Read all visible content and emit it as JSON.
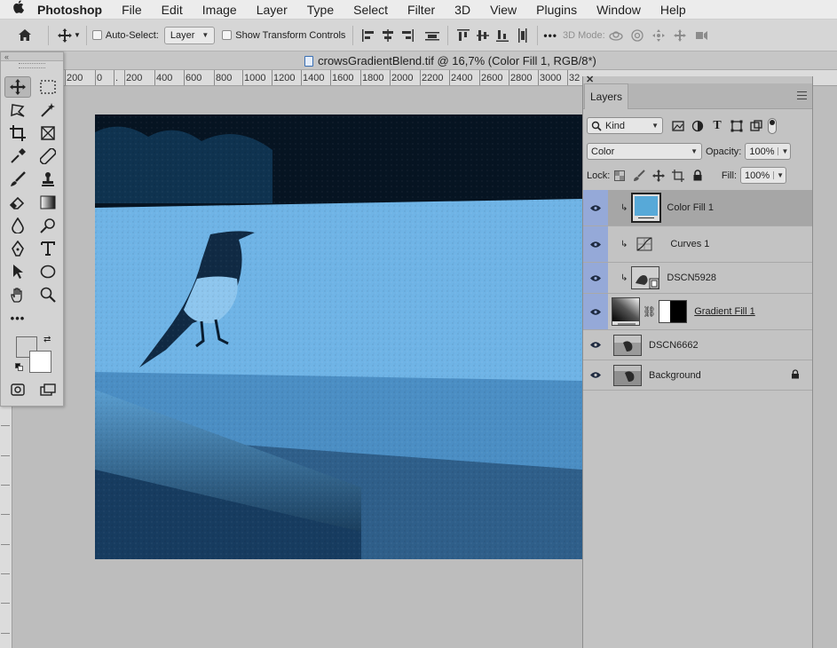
{
  "menubar": {
    "app": "Photoshop",
    "items": [
      "File",
      "Edit",
      "Image",
      "Layer",
      "Type",
      "Select",
      "Filter",
      "3D",
      "View",
      "Plugins",
      "Window",
      "Help"
    ]
  },
  "options_bar": {
    "auto_select_label": "Auto-Select:",
    "auto_select_target": "Layer",
    "show_transform_label": "Show Transform Controls",
    "more_label": "•••",
    "mode_3d_label": "3D Mode:"
  },
  "document": {
    "tab_title": "crowsGradientBlend.tif @ 16,7% (Color Fill 1, RGB/8*)"
  },
  "ruler": {
    "ticks": [
      "200",
      "0",
      ".",
      "200",
      "400",
      "600",
      "800",
      "1000",
      "1200",
      "1400",
      "1600",
      "1800",
      "2000",
      "2200",
      "2400",
      "2600",
      "2800",
      "3000",
      "32"
    ]
  },
  "layers_panel": {
    "tab_label": "Layers",
    "filter_kind": "Kind",
    "blend_mode": "Color",
    "opacity_label": "Opacity:",
    "opacity_value": "100%",
    "lock_label": "Lock:",
    "fill_label": "Fill:",
    "fill_value": "100%",
    "layers": [
      {
        "name": "Color Fill 1",
        "clipped": true,
        "active": true,
        "kind": "fill",
        "fill_color": "#57a9d8"
      },
      {
        "name": "Curves 1",
        "clipped": true,
        "kind": "adjustment"
      },
      {
        "name": "DSCN5928",
        "clipped": true,
        "kind": "smart-object"
      },
      {
        "name": "Gradient Fill 1",
        "clipped": false,
        "kind": "gradient-with-mask"
      },
      {
        "name": "DSCN6662",
        "clipped": false,
        "kind": "pixel"
      },
      {
        "name": "Background",
        "clipped": false,
        "kind": "background",
        "locked": true
      }
    ]
  },
  "colors": {
    "accent_blue_tint": "#4aa3d8",
    "selected_eye_column": "#95a9d8"
  }
}
